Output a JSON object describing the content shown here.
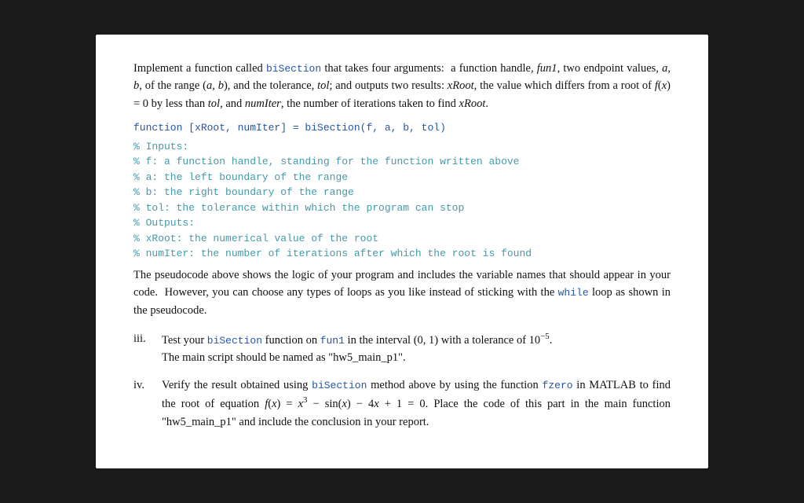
{
  "page": {
    "intro": {
      "line1": "Implement a function called ",
      "biSection1": "biSection",
      "line1b": " that takes four arguments:  a function handle,",
      "line2_italic_fun1": "fun1",
      "line2b": ", two endpoint values, ",
      "line2_a": "a, b",
      "line2c": ", of the range (",
      "line2_ab_math": "a, b",
      "line2d": "), and the tolerance, ",
      "line2_tol": "tol",
      "line2e": "; and outputs two",
      "line3a": "results: ",
      "line3_xRoot": "xRoot",
      "line3b": ", the value which differs from a root of ",
      "line3_fx": "f(x) = 0",
      "line3c": " by less than ",
      "line3_tol2": "tol",
      "line3d": ", and ",
      "line3_numIter": "numIter",
      "line3e": ",",
      "line4": "the number of iterations taken to find ",
      "line4_xRoot": "xRoot",
      "line4e": "."
    },
    "code": {
      "line1": "function [xRoot, numIter] = biSection(f, a, b, tol)",
      "comment_inputs": "% Inputs:",
      "comment_f": "% f: a function handle, standing for the function written above",
      "comment_a": "% a: the left boundary of the range",
      "comment_b": "% b: the right boundary of the range",
      "comment_tol": "% tol: the tolerance within which the program can stop",
      "comment_outputs": "% Outputs:",
      "comment_xRoot": "% xRoot: the numerical value of the root",
      "comment_numIter": "% numIter: the number of iterations after which the root is found"
    },
    "pseudocode_desc": {
      "line1": "The pseudocode above shows the logic of your program and includes the variable names",
      "line2": "that should appear in your code.  However, you can choose any types of loops as you like",
      "line3": "instead of sticking with the ",
      "while": "while",
      "line3b": " loop as shown in the pseudocode."
    },
    "items": [
      {
        "label": "iii.",
        "text_before": "Test your ",
        "code1": "biSection",
        "text_mid": " function on ",
        "code2": "fun1",
        "text_mid2": " in the interval (0, 1) with a tolerance of 10",
        "sup": "−5",
        "text_after": ".",
        "line2": "The main script should be named as \"hw5_main_p1\"."
      },
      {
        "label": "iv.",
        "text_before": "Verify the result obtained using ",
        "code1": "biSection",
        "text_mid": " method above by using the function ",
        "code2": "fzero",
        "line2": "in MATLAB to find the root of equation ",
        "math_eq": "f(x) = x³ − sin(x) − 4x + 1 = 0",
        "text_after": ". Place the code",
        "line3": "of this part in the main function \"hw5_main_p1\" and include the conclusion in your report."
      }
    ]
  }
}
